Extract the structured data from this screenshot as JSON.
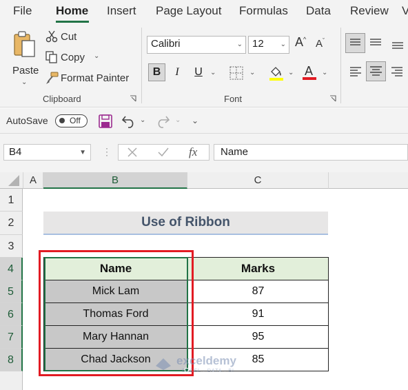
{
  "menu": {
    "tabs": [
      {
        "label": "File"
      },
      {
        "label": "Home",
        "active": true
      },
      {
        "label": "Insert"
      },
      {
        "label": "Page Layout"
      },
      {
        "label": "Formulas"
      },
      {
        "label": "Data"
      },
      {
        "label": "Review"
      },
      {
        "label": "V"
      }
    ]
  },
  "ribbon": {
    "clipboard": {
      "paste_label": "Paste",
      "cut_label": "Cut",
      "copy_label": "Copy",
      "format_painter_label": "Format Painter",
      "group_label": "Clipboard"
    },
    "font": {
      "font_name": "Calibri",
      "font_size": "12",
      "bold": "B",
      "italic": "I",
      "underline": "U",
      "group_label": "Font",
      "highlight_color": "#ffff00",
      "font_color": "#e21b23"
    }
  },
  "qat": {
    "autosave_label": "AutoSave",
    "autosave_state": "Off"
  },
  "formula_bar": {
    "name_box": "B4",
    "fx_label": "fx",
    "formula": "Name"
  },
  "grid": {
    "columns": [
      "A",
      "B",
      "C"
    ],
    "rows": [
      "1",
      "2",
      "3",
      "4",
      "5",
      "6",
      "7",
      "8"
    ],
    "title": "Use of Ribbon",
    "table": {
      "headers": [
        "Name",
        "Marks"
      ],
      "rows": [
        [
          "Mick Lam",
          "87"
        ],
        [
          "Thomas Ford",
          "91"
        ],
        [
          "Mary Hannan",
          "95"
        ],
        [
          "Chad Jackson",
          "85"
        ]
      ]
    }
  },
  "watermark": {
    "name": "exceldemy",
    "tagline": "EXCEL · DATA · BI"
  },
  "colors": {
    "accent": "#217346",
    "highlight_box": "#e21b23",
    "title_text": "#44546a",
    "header_fill": "#e2efda"
  }
}
